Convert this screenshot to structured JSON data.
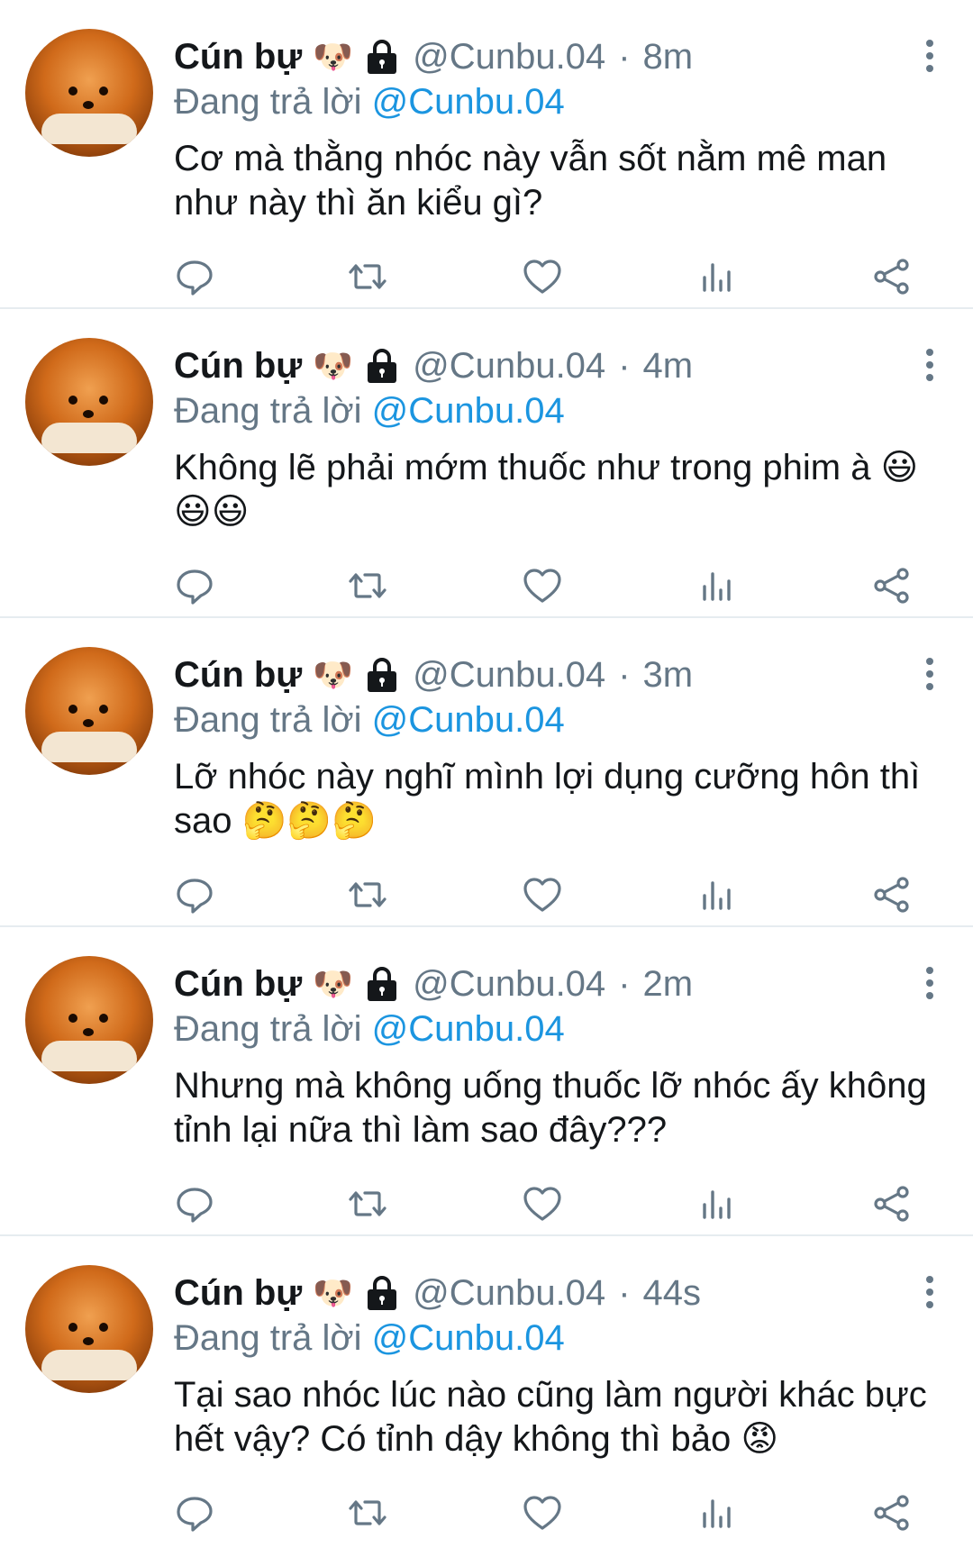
{
  "colors": {
    "accent": "#1b95e0",
    "muted": "#657786",
    "text": "#14171a",
    "divider": "#e6ecf0"
  },
  "tweets": [
    {
      "name": "Cún bự",
      "name_emoji": "🐶",
      "handle": "@Cunbu.04",
      "time": "8m",
      "replying_prefix": "Đang trả lời",
      "replying_to": "@Cunbu.04",
      "text": "Cơ mà thằng nhóc này vẫn sốt nằm mê man như này thì ăn kiểu gì?"
    },
    {
      "name": "Cún bự",
      "name_emoji": "🐶",
      "handle": "@Cunbu.04",
      "time": "4m",
      "replying_prefix": "Đang trả lời",
      "replying_to": "@Cunbu.04",
      "text": "Không lẽ phải mớm thuốc như trong phim à 😃😃😃"
    },
    {
      "name": "Cún bự",
      "name_emoji": "🐶",
      "handle": "@Cunbu.04",
      "time": "3m",
      "replying_prefix": "Đang trả lời",
      "replying_to": "@Cunbu.04",
      "text": "Lỡ nhóc này nghĩ mình lợi dụng cưỡng hôn thì sao 🤔🤔🤔"
    },
    {
      "name": "Cún bự",
      "name_emoji": "🐶",
      "handle": "@Cunbu.04",
      "time": "2m",
      "replying_prefix": "Đang trả lời",
      "replying_to": "@Cunbu.04",
      "text": "Nhưng mà không uống thuốc lỡ nhóc ấy không tỉnh lại nữa thì làm sao đây???"
    },
    {
      "name": "Cún bự",
      "name_emoji": "🐶",
      "handle": "@Cunbu.04",
      "time": "44s",
      "replying_prefix": "Đang trả lời",
      "replying_to": "@Cunbu.04",
      "text": "Tại sao nhóc lúc nào cũng làm người khác bực hết vậy? Có tỉnh dậy không thì bảo 😡"
    }
  ],
  "icons": {
    "reply": "reply-icon",
    "retweet": "retweet-icon",
    "like": "like-icon",
    "analytics": "analytics-icon",
    "share": "share-icon",
    "more": "more-vertical-icon",
    "lock": "lock-icon"
  }
}
